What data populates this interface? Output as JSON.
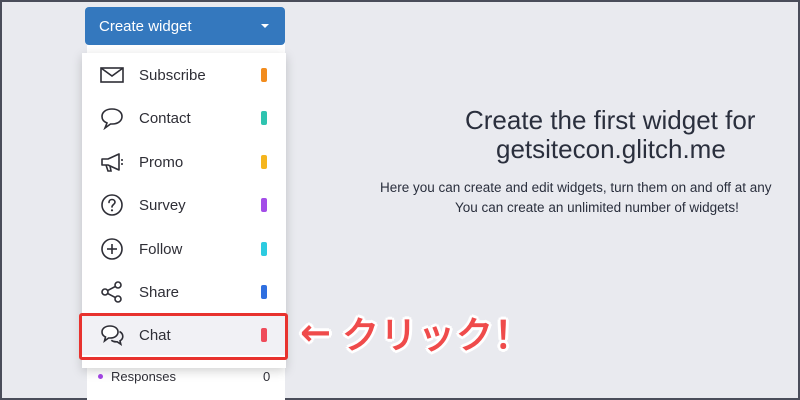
{
  "header": {
    "create_button_label": "Create widget"
  },
  "menu": {
    "items": [
      {
        "label": "Subscribe",
        "icon": "envelope-icon",
        "color": "#f28c1e"
      },
      {
        "label": "Contact",
        "icon": "speech-bubble-icon",
        "color": "#2ec4b0"
      },
      {
        "label": "Promo",
        "icon": "megaphone-icon",
        "color": "#f5b51d"
      },
      {
        "label": "Survey",
        "icon": "question-icon",
        "color": "#a34de8"
      },
      {
        "label": "Follow",
        "icon": "plus-circle-icon",
        "color": "#2ccbe0"
      },
      {
        "label": "Share",
        "icon": "share-icon",
        "color": "#2f6fe0"
      },
      {
        "label": "Chat",
        "icon": "chat-bubbles-icon",
        "color": "#ef4b5a"
      }
    ]
  },
  "responses": {
    "label": "Responses",
    "count": "0",
    "color": "#a044e0"
  },
  "annotation": {
    "arrow": "←",
    "text": "クリック！",
    "color": "#ef4b4b"
  },
  "main": {
    "title_line1": "Create the first widget for",
    "title_line2": "getsitecon.glitch.me",
    "desc_line1": "Here you can create and edit widgets, turn them on and off at any",
    "desc_line2": "You can create an unlimited number of widgets!"
  }
}
